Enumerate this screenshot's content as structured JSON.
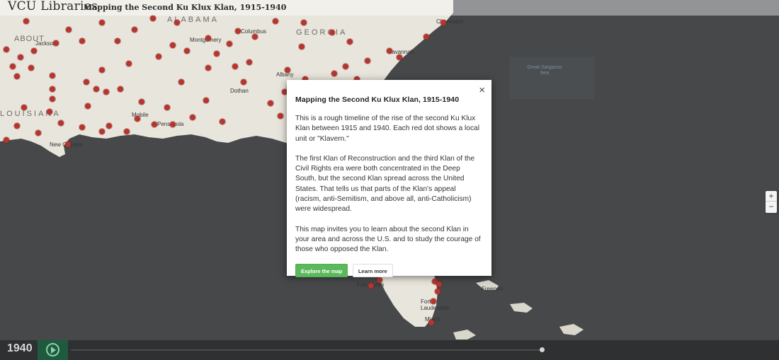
{
  "header": {
    "brand": "VCU Libraries",
    "title": "Mapping the Second Ku Klux Klan, 1915-1940"
  },
  "map": {
    "state_labels": [
      "ALABAMA",
      "GEORGIA",
      "LOUISIANA",
      "ABOUT"
    ],
    "city_labels": [
      "Jackson",
      "Montgomery",
      "Columbus",
      "Savannah",
      "Charleston",
      "Albany",
      "Dothan",
      "Pensacola",
      "Mobile",
      "New Orleans",
      "Fort Myers",
      "Fort Lauderdale",
      "Miami",
      "Freeport"
    ],
    "water_labels": [
      "Great Sargasso Sea"
    ],
    "zoom_in": "+",
    "zoom_out": "−"
  },
  "modal": {
    "close": "×",
    "title": "Mapping the Second Ku Klux Klan, 1915-1940",
    "paragraphs": [
      "This is a rough timeline of the rise of the second Ku Klux Klan between 1915 and 1940. Each red dot shows a local unit or \"Klavern.\"",
      "The first Klan of Reconstruction and the third Klan of the Civil Rights era were both concentrated in the Deep South, but the second Klan spread across the United States. That tells us that parts of the Klan's appeal (racism, anti-Semitism, and above all, anti-Catholicism) were widespread.",
      "This map invites you to learn about the second Klan in your area and across the U.S. and to study the courage of those who opposed the Klan."
    ],
    "explore_label": "Explore the map",
    "learn_label": "Learn more"
  },
  "timeline": {
    "year": "1940",
    "progress": 1.0
  },
  "colors": {
    "dot": "#b5362f",
    "land": "#e8e5dc",
    "water": "#46484a",
    "play_bg": "#1f5a3e",
    "primary_button": "#5cb85c"
  }
}
